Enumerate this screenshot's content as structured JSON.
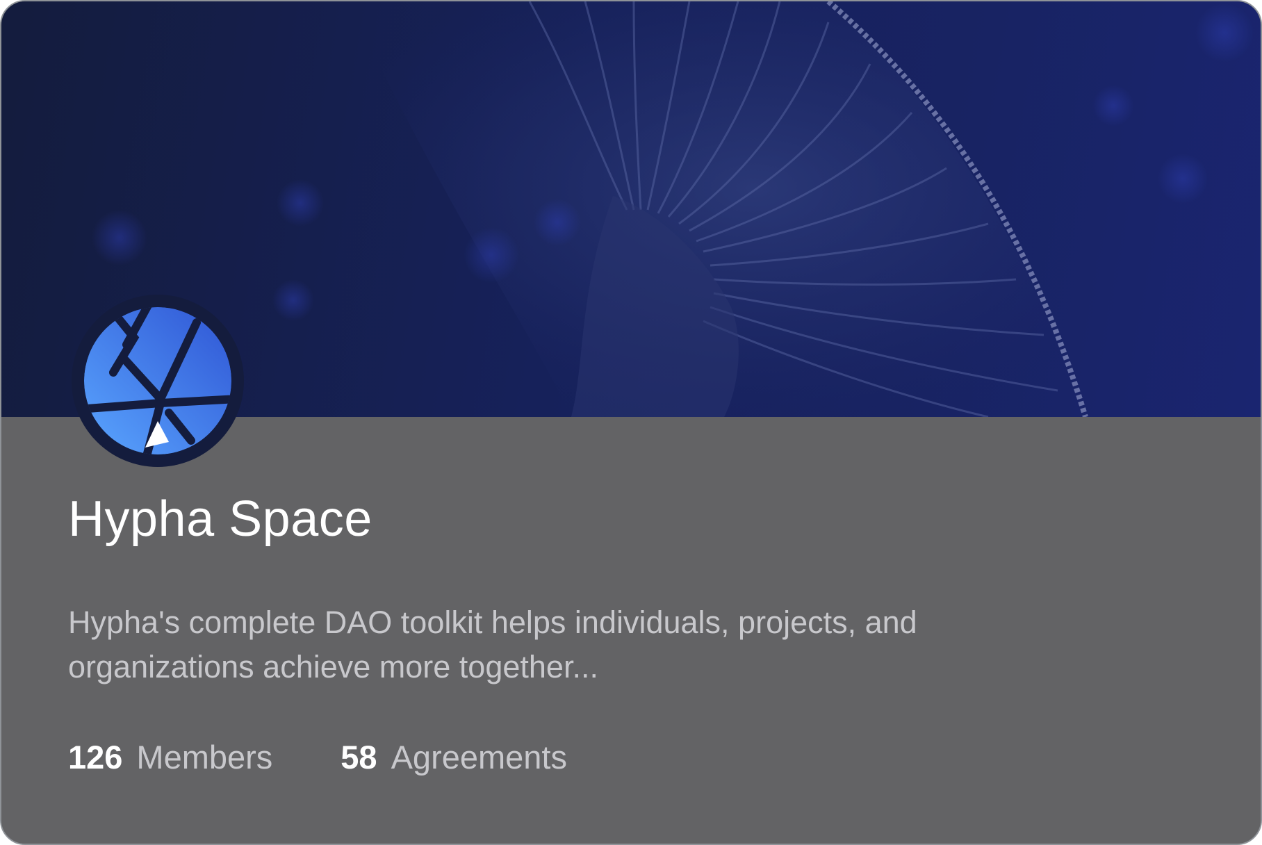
{
  "space": {
    "name": "Hypha Space",
    "description": "Hypha's complete DAO toolkit helps individuals, projects, and organizations achieve more together...",
    "banner_image": "mushroom-gills-photo",
    "logo_icon": "hypha-logo-icon"
  },
  "stats": {
    "members_count": "126",
    "members_label": "Members",
    "agreements_count": "58",
    "agreements_label": "Agreements"
  },
  "colors": {
    "banner_dark": "#141c3d",
    "banner_blue": "#1a2570",
    "card_body": "#636365",
    "card_border": "#8f9398",
    "logo_blue_light": "#5aa6ff",
    "logo_blue_dark": "#2f55d4",
    "title_text": "#ffffff",
    "muted_text": "#c8c8cc"
  }
}
